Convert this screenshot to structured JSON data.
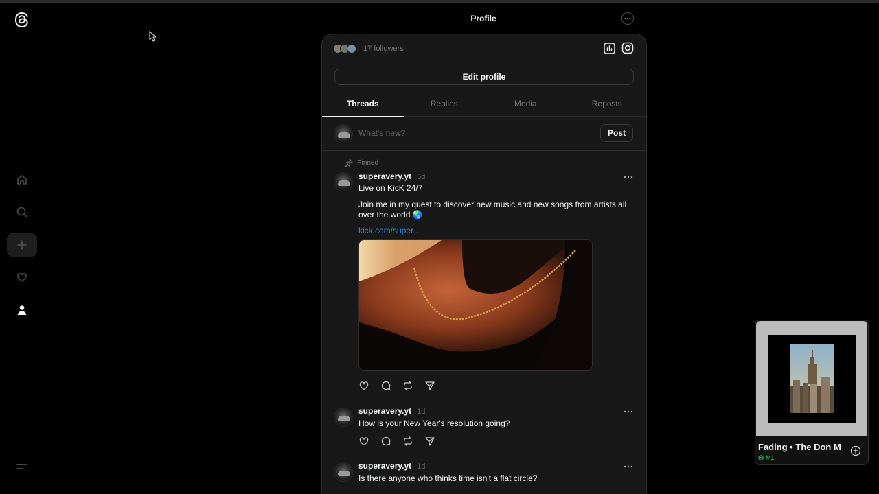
{
  "header": {
    "title": "Profile"
  },
  "profile": {
    "followers_text": "17 followers",
    "edit_profile_label": "Edit profile"
  },
  "tabs": [
    {
      "label": "Threads",
      "active": true
    },
    {
      "label": "Replies",
      "active": false
    },
    {
      "label": "Media",
      "active": false
    },
    {
      "label": "Reposts",
      "active": false
    }
  ],
  "composer": {
    "placeholder": "What's new?",
    "post_label": "Post"
  },
  "posts": [
    {
      "pinned_label": "Pinned",
      "username": "superavery.yt",
      "time": "5d",
      "title": "Live on KicK 24/7",
      "body": "Join me in my quest to discover new music and new songs from artists all over the world 🌏",
      "link": "kick.com/super..."
    },
    {
      "username": "superavery.yt",
      "time": "1d",
      "body": "How is your New Year's resolution going?"
    },
    {
      "username": "superavery.yt",
      "time": "1d",
      "body": "Is there anyone who thinks time isn't a flat circle?"
    }
  ],
  "player": {
    "track": "Fading • The Don Mas",
    "device": "M1"
  },
  "colors": {
    "background": "#000000",
    "panel": "#181818",
    "link": "#3d8be0",
    "device_green": "#1ed760"
  },
  "icons": {
    "logo": "threads-logo-icon",
    "home": "home-icon",
    "search": "search-icon",
    "create": "plus-icon",
    "activity": "heart-icon",
    "profile": "person-icon",
    "menu": "menu-icon",
    "insights": "insights-icon",
    "instagram": "instagram-icon"
  }
}
